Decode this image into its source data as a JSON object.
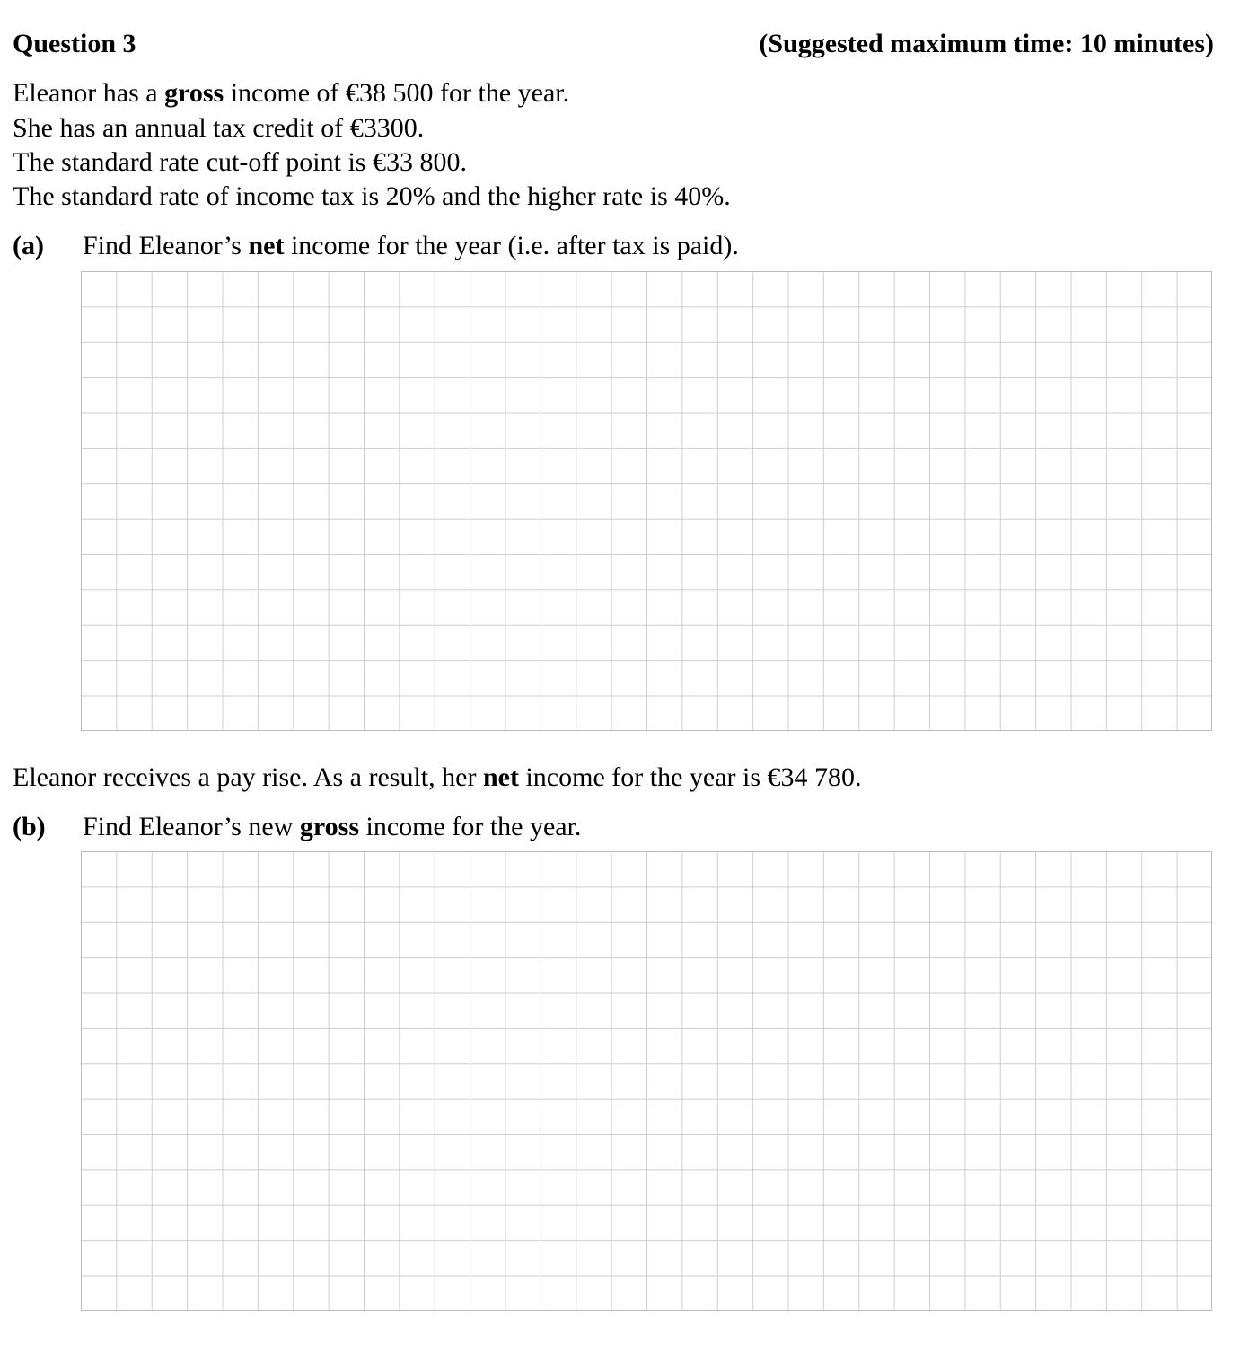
{
  "question": {
    "title": "Question 3",
    "time_note": "(Suggested maximum time: 10 minutes)"
  },
  "intro": {
    "line1": {
      "pre": "Eleanor has a ",
      "bold": "gross",
      "post": " income of €38 500 for the year."
    },
    "line2": "She has an annual tax credit of €3300.",
    "line3": "The standard rate cut-off point is €33 800.",
    "line4": "The standard rate of income tax is 20% and the higher rate is 40%."
  },
  "part_a": {
    "label": "(a)",
    "pre": "Find Eleanor’s ",
    "bold": "net",
    "post": " income for the year (i.e. after tax is paid)."
  },
  "middle": {
    "pre": "Eleanor receives a pay rise.  As a result, her ",
    "bold": "net",
    "post": " income for the year is €34 780."
  },
  "part_b": {
    "label": "(b)",
    "pre": "Find Eleanor’s new ",
    "bold": "gross",
    "post": " income for the year."
  }
}
